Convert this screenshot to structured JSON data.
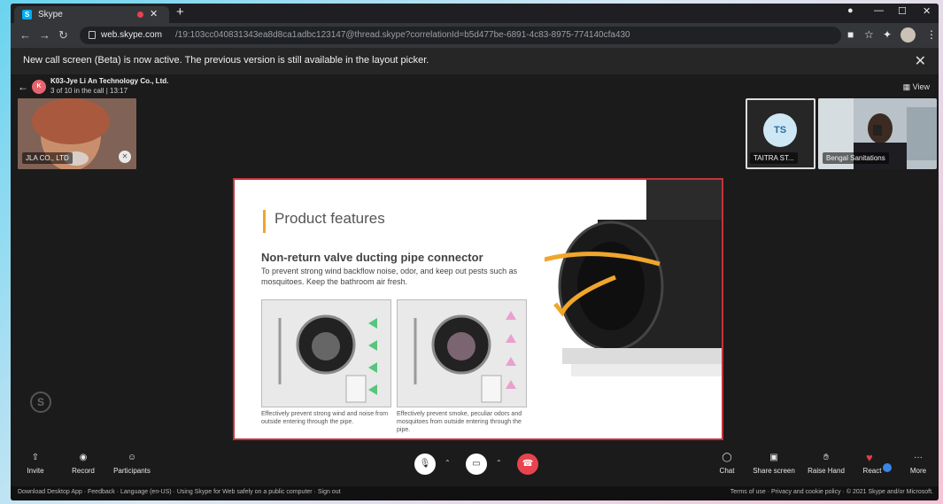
{
  "browser": {
    "tab_title": "Skype",
    "tab_favicon": "S",
    "url_host": "web.skype.com",
    "url_path": "/19:103cc040831343ea8d8ca1adbc123147@thread.skype?correlationId=b5d477be-6891-4c83-8975-774140cfa430"
  },
  "notice": {
    "text": "New call screen (Beta) is now active. The previous version is still available in the layout picker."
  },
  "call": {
    "group_name": "K03-Jye Li An Technology Co., Ltd.",
    "info": "3 of 10 in the call | 13:17",
    "avatar_initials": "K",
    "view_label": "View"
  },
  "participants": [
    {
      "label": "JLA CO., LTD"
    },
    {
      "label": "TAITRA ST...",
      "initials": "TS"
    },
    {
      "label": "Bengal Sanitations"
    }
  ],
  "slide": {
    "title": "Product features",
    "subtitle": "Non-return valve ducting pipe connector",
    "description": "To prevent strong wind backflow noise, odor, and keep out pests such as mosquitoes. Keep the bathroom air fresh.",
    "caption_left": "Effectively prevent strong wind and noise from outside entering through the pipe.",
    "caption_right": "Effectively prevent smoke, peculiar odors and mosquitoes from outside entering through the pipe."
  },
  "controls": {
    "left": [
      "Invite",
      "Record",
      "Participants"
    ],
    "right": [
      "Chat",
      "Share screen",
      "Raise Hand",
      "React",
      "More"
    ]
  },
  "footer": {
    "left": [
      "Download Desktop App",
      "Feedback",
      "Language (en-US)",
      "Using Skype for Web safely on a public computer",
      "Sign out"
    ],
    "right": [
      "Terms of use",
      "Privacy and cookie policy",
      "© 2021 Skype and/or Microsoft."
    ]
  },
  "colors": {
    "skype_blue": "#00aff0",
    "end_call_red": "#e8434f",
    "slide_border": "#c4333b",
    "accent_orange": "#f0a62b"
  }
}
